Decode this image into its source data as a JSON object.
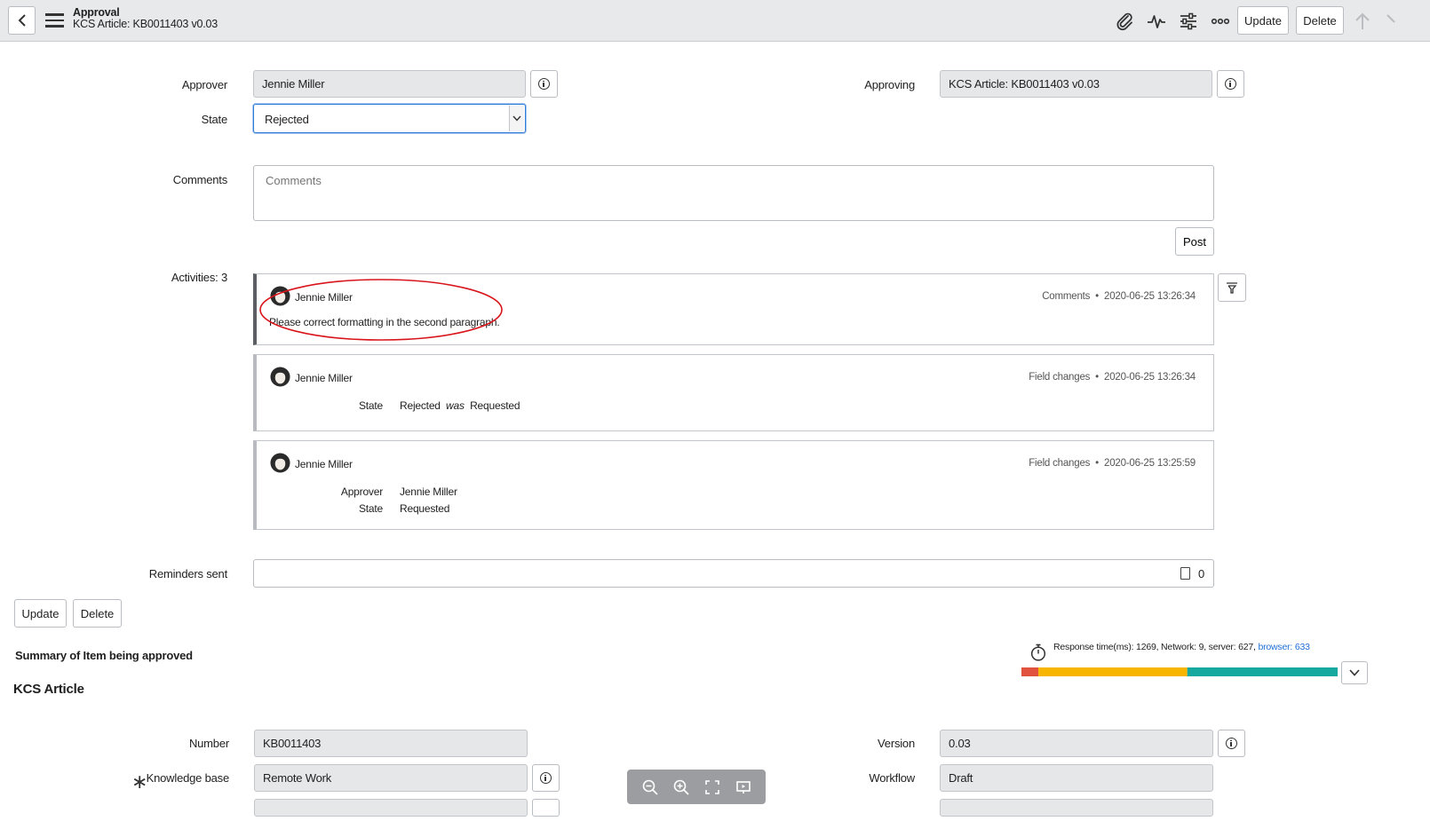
{
  "header": {
    "title": "Approval",
    "subtitle": "KCS Article: KB0011403 v0.03",
    "update_label": "Update",
    "delete_label": "Delete"
  },
  "form": {
    "approver_label": "Approver",
    "approver_value": "Jennie Miller",
    "approving_label": "Approving",
    "approving_value": "KCS Article: KB0011403 v0.03",
    "state_label": "State",
    "state_value": "Rejected",
    "comments_label": "Comments",
    "comments_placeholder": "Comments",
    "post_label": "Post",
    "activities_label": "Activities: 3",
    "reminders_label": "Reminders sent",
    "reminders_value": "0"
  },
  "activities": [
    {
      "user": "Jennie Miller",
      "type": "Comments",
      "time": "2020-06-25 13:26:34",
      "message": "Please correct formatting in the second paragraph."
    },
    {
      "user": "Jennie Miller",
      "type": "Field changes",
      "time": "2020-06-25 13:26:34",
      "f1_name": "State",
      "f1_new": "Rejected",
      "f1_was": "was",
      "f1_old": "Requested"
    },
    {
      "user": "Jennie Miller",
      "type": "Field changes",
      "time": "2020-06-25 13:25:59",
      "f1_name": "Approver",
      "f1_value": "Jennie Miller",
      "f2_name": "State",
      "f2_value": "Requested"
    }
  ],
  "bottom_actions": {
    "update_label": "Update",
    "delete_label": "Delete"
  },
  "summary": {
    "heading": "Summary of Item being approved",
    "section": "KCS Article",
    "number_label": "Number",
    "number_value": "KB0011403",
    "version_label": "Version",
    "version_value": "0.03",
    "kb_label": "Knowledge base",
    "kb_value": "Remote Work",
    "workflow_label": "Workflow",
    "workflow_value": "Draft"
  },
  "response": {
    "text": "Response time(ms): 1269, Network: 9, server: 627,",
    "browser_link": "browser: 633",
    "segments": [
      {
        "label": "network",
        "color": "#e2533f",
        "ms": 9
      },
      {
        "label": "server",
        "color": "#f7b500",
        "ms": 627
      },
      {
        "label": "browser",
        "color": "#16a9a0",
        "ms": 633
      }
    ]
  },
  "colors": {
    "accent": "#2f7bd6",
    "highlight_ring": "#d9141b"
  }
}
